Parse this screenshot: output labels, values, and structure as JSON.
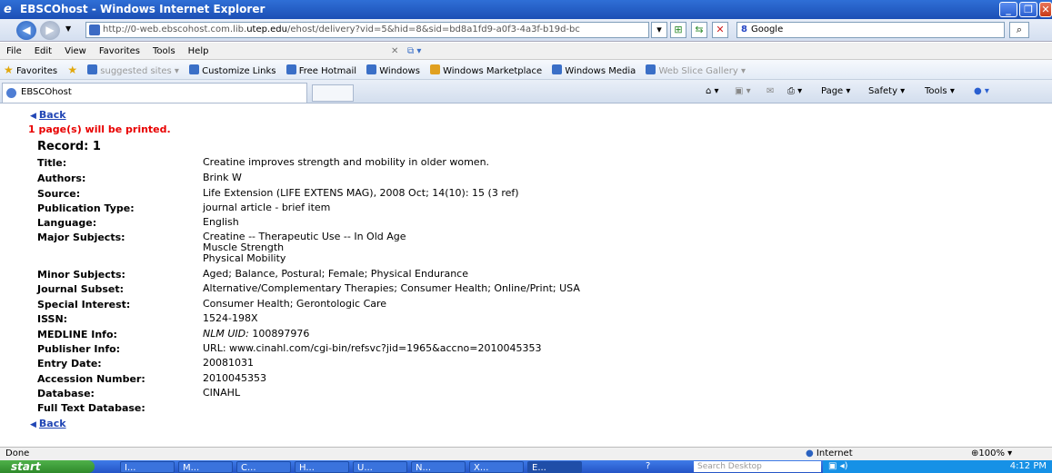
{
  "window": {
    "title": "EBSCOhost - Windows Internet Explorer"
  },
  "address": {
    "url_prefix": "http://0-web.ebscohost.com.lib.",
    "url_domain": "utep.edu",
    "url_suffix": "/ehost/delivery?vid=5&hid=8&sid=bd8a1fd9-a0f3-4a3f-b19d-bc",
    "search_label": "Google"
  },
  "menu": [
    "File",
    "Edit",
    "View",
    "Favorites",
    "Tools",
    "Help"
  ],
  "favorites": {
    "label": "Favorites",
    "items": [
      "suggested sites ▾",
      "Customize Links",
      "Free Hotmail",
      "Windows",
      "Windows Marketplace",
      "Windows Media",
      "Web Slice Gallery ▾"
    ]
  },
  "tab": {
    "label": "EBSCOhost"
  },
  "commands": [
    "Page ▾",
    "Safety ▾",
    "Tools ▾"
  ],
  "content": {
    "back_label": "Back",
    "printed_notice": "1 page(s) will be printed.",
    "record_label": "Record: 1",
    "fields": [
      {
        "label": "Title:",
        "value": "Creatine improves strength and mobility in older women."
      },
      {
        "label": "Authors:",
        "value": "Brink W"
      },
      {
        "label": "Source:",
        "value": "Life Extension (LIFE EXTENS MAG), 2008 Oct; 14(10): 15 (3 ref)"
      },
      {
        "label": "Publication Type:",
        "value": "journal article - brief item"
      },
      {
        "label": "Language:",
        "value": "English"
      },
      {
        "label": "Major Subjects:",
        "value": "Creatine -- Therapeutic Use -- In Old Age",
        "value2": "Muscle Strength",
        "value3": "Physical Mobility"
      },
      {
        "label": "Minor Subjects:",
        "value": "Aged; Balance, Postural; Female; Physical Endurance"
      },
      {
        "label": "Journal Subset:",
        "value": "Alternative/Complementary Therapies; Consumer Health; Online/Print; USA"
      },
      {
        "label": "Special Interest:",
        "value": "Consumer Health; Gerontologic Care"
      },
      {
        "label": "ISSN:",
        "value": "1524-198X"
      },
      {
        "label": "MEDLINE Info:",
        "value_italic": "NLM UID:",
        "value": " 100897976"
      },
      {
        "label": "Publisher Info:",
        "value": "URL: www.cinahl.com/cgi-bin/refsvc?jid=1965&accno=2010045353"
      },
      {
        "label": "Entry Date:",
        "value": "20081031"
      },
      {
        "label": "Accession Number:",
        "value": "2010045353"
      },
      {
        "label": "Database:",
        "value": "CINAHL"
      },
      {
        "label": "Full Text Database:",
        "value": ""
      }
    ]
  },
  "status": {
    "left": "Done",
    "zone": "Internet",
    "zoom": "100%"
  },
  "taskbar": {
    "start": "start",
    "buttons": [
      "I...",
      "M...",
      "C...",
      "H...",
      "U...",
      "N...",
      "X...",
      "E..."
    ],
    "search_placeholder": "Search Desktop",
    "clock": "4:12 PM"
  }
}
